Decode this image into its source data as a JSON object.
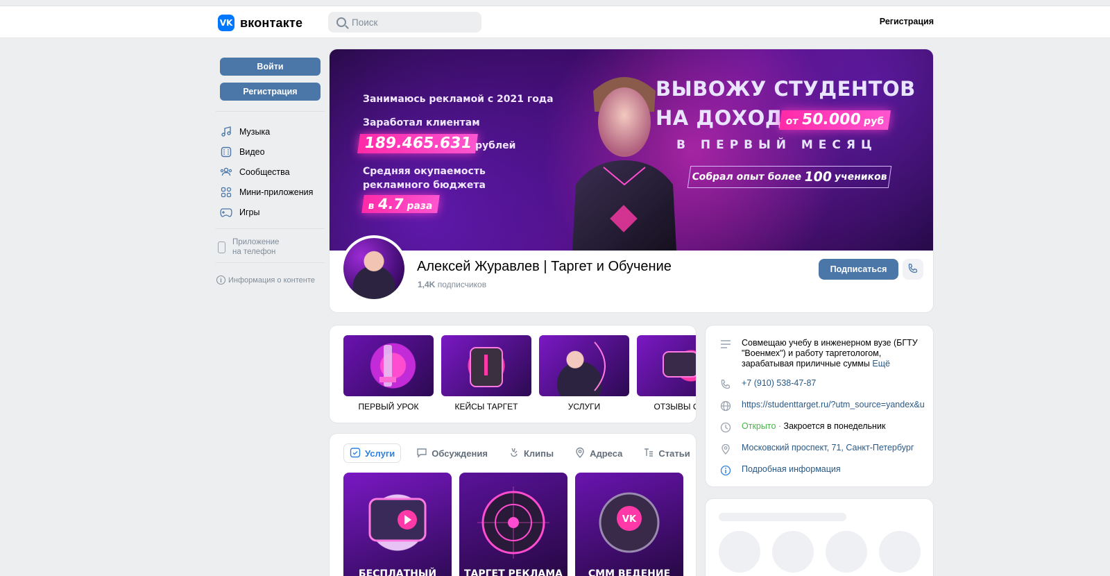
{
  "header": {
    "logo_text": "вконтакте",
    "logo_mark": "VK",
    "search_placeholder": "Поиск",
    "register_link": "Регистрация"
  },
  "sidebar": {
    "login_button": "Войти",
    "register_button": "Регистрация",
    "items": [
      {
        "label": "Музыка",
        "icon": "music-icon"
      },
      {
        "label": "Видео",
        "icon": "video-icon"
      },
      {
        "label": "Сообщества",
        "icon": "communities-icon"
      },
      {
        "label": "Мини-приложения",
        "icon": "mini-apps-icon"
      },
      {
        "label": "Игры",
        "icon": "games-icon"
      }
    ],
    "app_link_line1": "Приложение",
    "app_link_line2": "на телефон",
    "content_info": "Информация о контенте"
  },
  "cover": {
    "line1": "Занимаюсь рекламой с 2021 года",
    "line2": "Заработал клиентам",
    "earned_value": "189.465.631",
    "earned_unit": "рублей",
    "line3a": "Средняя окупаемость",
    "line3b": "рекламного бюджета",
    "roi_prefix": "в",
    "roi_value": "4.7",
    "roi_suffix": "раза",
    "headline1": "ВЫВОЖУ СТУДЕНТОВ",
    "headline2": "НА ДОХОД",
    "income_prefix": "от",
    "income_value": "50.000",
    "income_suffix": "руб",
    "headline3": "В ПЕРВЫЙ МЕСЯЦ",
    "experience_prefix": "Собрал опыт более",
    "experience_value": "100",
    "experience_suffix": "учеников"
  },
  "profile": {
    "name": "Алексей Журавлев | Таргет и Обучение",
    "subscribers_count": "1,4K",
    "subscribers_label": "подписчиков",
    "subscribe_button": "Подписаться"
  },
  "highlights": [
    {
      "label": "ПЕРВЫЙ УРОК"
    },
    {
      "label": "КЕЙСЫ ТАРГЕТ"
    },
    {
      "label": "УСЛУГИ"
    },
    {
      "label": "ОТЗЫВЫ ОБУ"
    }
  ],
  "tabs": [
    {
      "label": "Услуги",
      "active": true
    },
    {
      "label": "Обсуждения"
    },
    {
      "label": "Клипы"
    },
    {
      "label": "Адреса"
    },
    {
      "label": "Статьи"
    }
  ],
  "services": [
    {
      "title": "БЕСПЛАТНЫЙ"
    },
    {
      "title": "ТАРГЕТ РЕКЛАМА"
    },
    {
      "title": "СММ ВЕДЕНИЕ"
    }
  ],
  "info": {
    "description": "Совмещаю учебу в инженерном вузе (БГТУ \"Военмех\") и работу таргетологом, зарабатывая приличные суммы",
    "more": "Ещё",
    "phone": "+7 (910) 538-47-87",
    "website": "https://studenttarget.ru/?utm_source=yandex&u",
    "status_open": "Открыто",
    "status_close": "Закроется в понедельник",
    "address": "Московский проспект, 71, Санкт-Петербург",
    "details": "Подробная информация"
  },
  "colors": {
    "accent": "#4a76a8",
    "link": "#2a5885",
    "open_green": "#4bb34b",
    "cover_pink": "#ff2aa8"
  }
}
